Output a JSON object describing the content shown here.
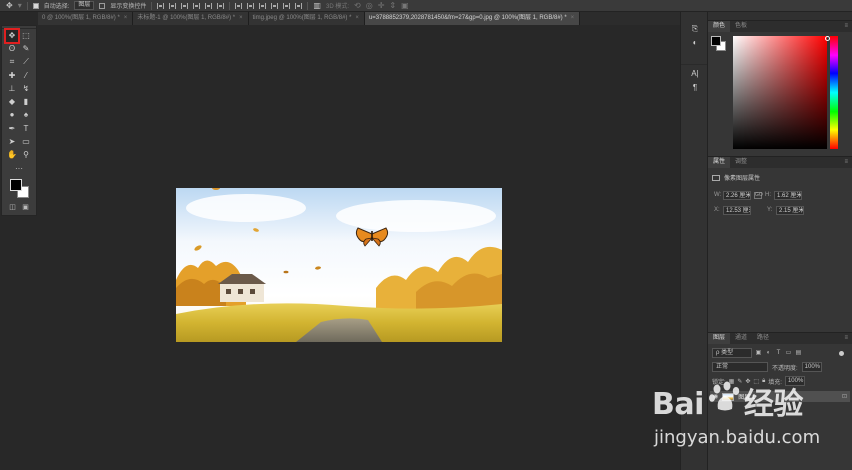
{
  "options_bar": {
    "auto_select_label": "自动选择:",
    "auto_select_value": "图层",
    "show_transform_label": "显示变换控件",
    "mode_3d_label": "3D 模式:"
  },
  "tabs": [
    {
      "label": "0 @ 100%(图层 1, RGB/8#) *",
      "active": false
    },
    {
      "label": "未标题-1 @ 100%(图层 1, RGB/8#) *",
      "active": false
    },
    {
      "label": "timg.jpeg @ 100%(图层 1, RGB/8#) *",
      "active": false
    },
    {
      "label": "u=3788852379,2028781450&fm=27&gp=0.jpg @ 100%(图层 1, RGB/8#) *",
      "active": true
    }
  ],
  "color_panel": {
    "tabs": [
      "颜色",
      "色板"
    ],
    "fg_color": "#000000",
    "bg_color": "#ffffff"
  },
  "properties_panel": {
    "tabs": [
      "属性",
      "调整"
    ],
    "heading": "像素图层属性",
    "w_label": "W:",
    "w_value": "2.26 厘米",
    "h_label": "H:",
    "h_value": "1.62 厘米",
    "x_label": "X:",
    "x_value": "12.53 厘米",
    "y_label": "Y:",
    "y_value": "2.15 厘米",
    "link_label": "GO"
  },
  "layers_panel": {
    "tabs": [
      "图层",
      "通道",
      "路径"
    ],
    "filter_kind": "ρ 类型",
    "blend_mode": "正常",
    "opacity_label": "不透明度:",
    "opacity_value": "100%",
    "lock_label": "锁定:",
    "fill_label": "填充:",
    "fill_value": "100%",
    "layer_name": "图层 1"
  },
  "watermark": {
    "logo_text": "Bai",
    "logo_suffix": "经验",
    "url": "jingyan.baidu.com"
  },
  "colors": {
    "selected_tool_outline": "#e02020",
    "canvas_bg": "#282828"
  },
  "icons": {
    "tools": [
      "move-icon",
      "marquee-icon",
      "lasso-icon",
      "magic-wand-icon",
      "crop-icon",
      "eyedropper-icon",
      "healing-brush-icon",
      "brush-icon",
      "clone-stamp-icon",
      "history-brush-icon",
      "eraser-icon",
      "gradient-icon",
      "blur-icon",
      "dodge-icon",
      "pen-icon",
      "type-icon",
      "path-select-icon",
      "rectangle-icon",
      "hand-icon",
      "zoom-icon"
    ]
  }
}
